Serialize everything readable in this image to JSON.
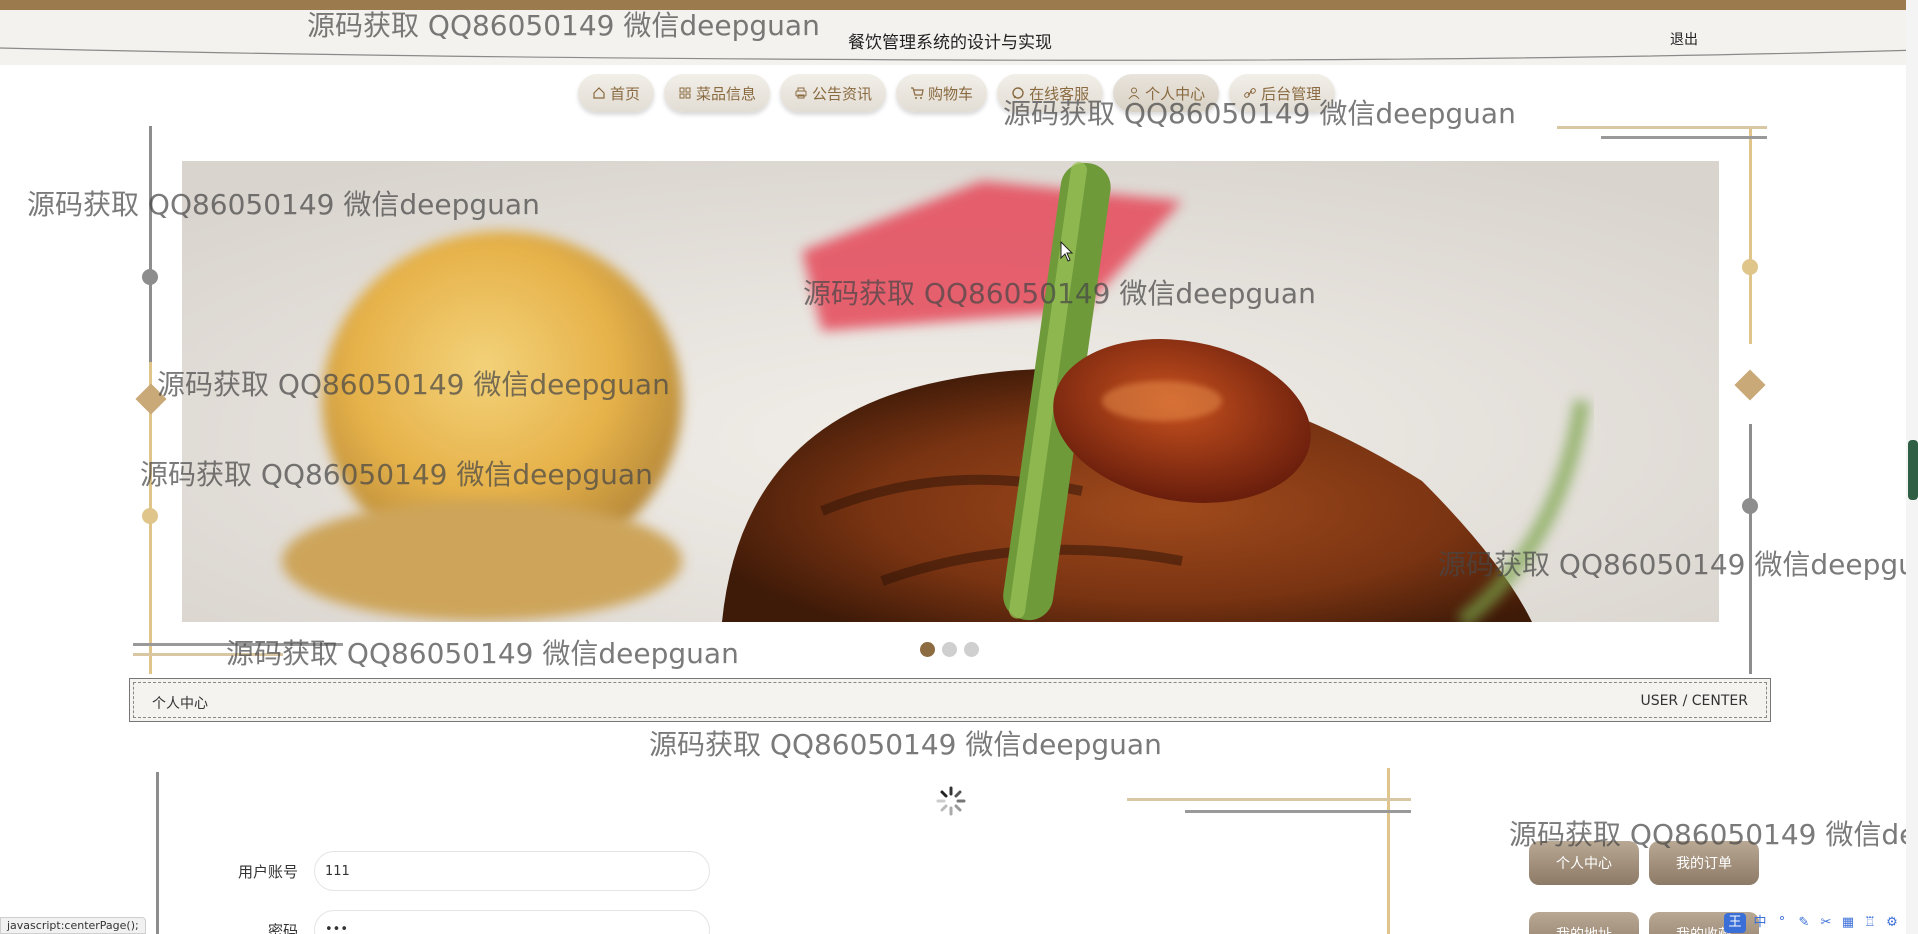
{
  "header": {
    "site_title": "餐饮管理系统的设计与实现",
    "logout_label": "退出"
  },
  "nav": {
    "items": [
      {
        "label": "首页",
        "icon": "home-icon"
      },
      {
        "label": "菜品信息",
        "icon": "grid-icon"
      },
      {
        "label": "公告资讯",
        "icon": "printer-icon"
      },
      {
        "label": "购物车",
        "icon": "cart-icon"
      },
      {
        "label": "在线客服",
        "icon": "chat-icon"
      },
      {
        "label": "个人中心",
        "icon": "user-icon"
      },
      {
        "label": "后台管理",
        "icon": "link-icon"
      }
    ],
    "active_index": 5
  },
  "banner": {
    "description_alt": "banner-image",
    "dots": 3,
    "active_dot": 0
  },
  "section": {
    "title": "个人中心",
    "title_en": "USER / CENTER"
  },
  "form": {
    "account_label": "用户账号",
    "account_value": "111",
    "password_label": "密码",
    "password_value": "•••"
  },
  "side_menu": {
    "items": [
      "个人中心",
      "我的订单",
      "我的地址",
      "我的收藏"
    ]
  },
  "watermark": {
    "text": "源码获取 QQ86050149 微信deepguan"
  },
  "status_bar": {
    "text": "javascript:centerPage();"
  },
  "ime": {
    "badge": "王",
    "lang": "中"
  },
  "colors": {
    "accent": "#9b7b4e",
    "nav_text": "#8a6a40",
    "active_dot": "#8e6c42"
  }
}
